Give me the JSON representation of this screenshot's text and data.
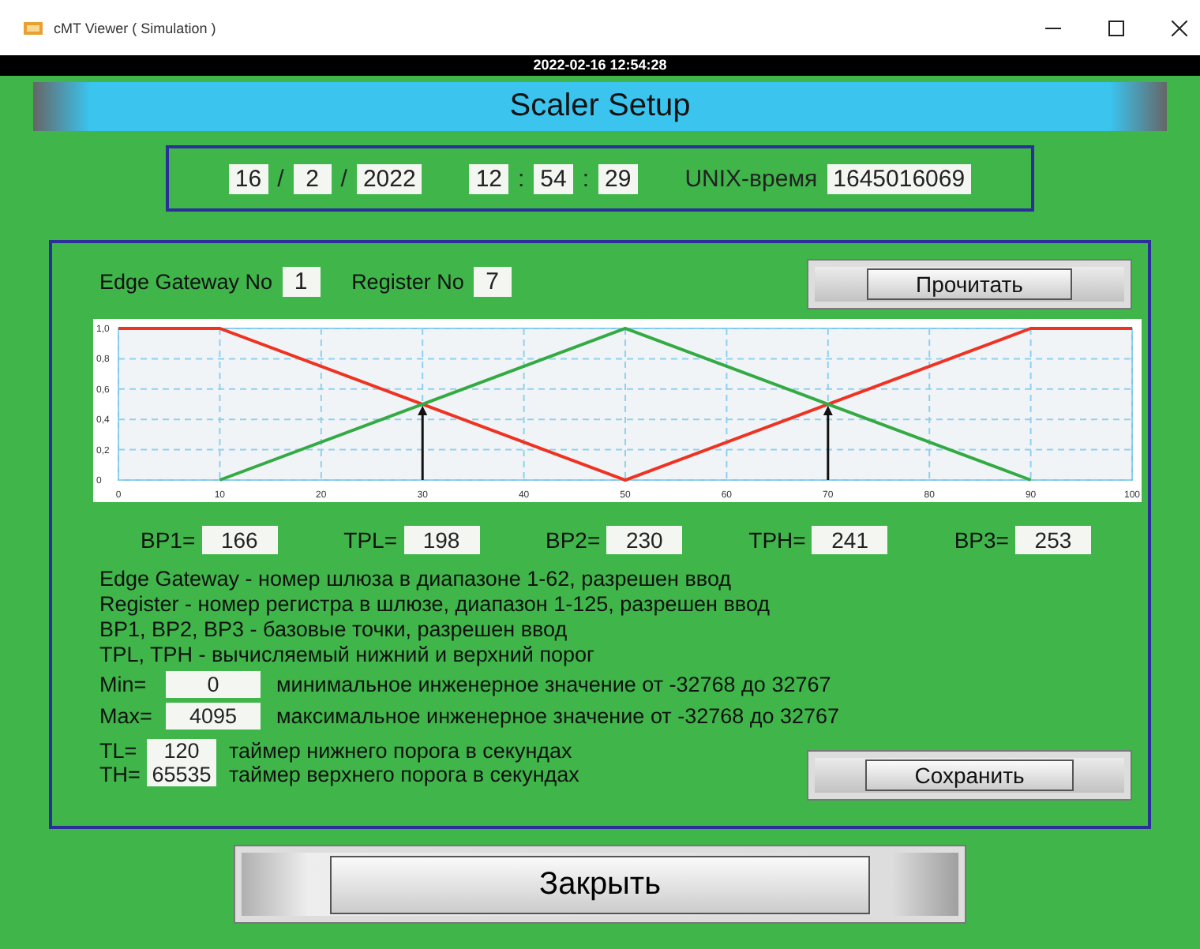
{
  "window": {
    "title": "cMT Viewer ( Simulation )"
  },
  "status_bar": {
    "datetime": "2022-02-16 12:54:28"
  },
  "header": {
    "title": "Scaler Setup"
  },
  "date_time": {
    "fields": [
      {
        "value": "16",
        "sep": "/"
      },
      {
        "value": "2",
        "sep": "/"
      },
      {
        "value": "2022"
      },
      {
        "value": "12",
        "sep": ":"
      },
      {
        "value": "54",
        "sep": ":"
      },
      {
        "value": "29"
      }
    ],
    "unix_label": "UNIX-время",
    "unix_value": "1645016069"
  },
  "gateway": {
    "label": "Edge Gateway No",
    "value": "1"
  },
  "register": {
    "label": "Register No",
    "value": "7"
  },
  "read_button": "Прочитать",
  "chart_data": {
    "type": "line",
    "x": [
      0,
      10,
      50,
      90,
      100
    ],
    "series": [
      {
        "color": "#ee3322",
        "values": [
          1,
          1,
          0,
          1,
          1
        ]
      },
      {
        "color": "#33aa44",
        "values": [
          null,
          0,
          1,
          0,
          null
        ]
      }
    ],
    "grid": true,
    "xlim": [
      0,
      100
    ],
    "ylim": [
      0,
      1
    ],
    "xticks": [
      0,
      10,
      20,
      30,
      40,
      50,
      60,
      70,
      80,
      90,
      100
    ],
    "yticks": [
      {
        "value": 0,
        "label": "0"
      },
      {
        "value": 0.2,
        "label": "0,2"
      },
      {
        "value": 0.4,
        "label": "0,4"
      },
      {
        "value": 0.6,
        "label": "0,6"
      },
      {
        "value": 0.8,
        "label": "0,8"
      },
      {
        "value": 1,
        "label": "1,0"
      }
    ]
  },
  "points": [
    {
      "label": "BP1=",
      "value": "166"
    },
    {
      "label": "TPL=",
      "value": "198"
    },
    {
      "label": "BP2=",
      "value": "230"
    },
    {
      "label": "TPH=",
      "value": "241"
    },
    {
      "label": "BP3=",
      "value": "253"
    }
  ],
  "notes": [
    "Edge Gateway - номер шлюза в диапазоне 1-62, разрешен ввод",
    "Register - номер регистра в шлюзе, диапазон 1-125, разрешен ввод",
    "BP1, BP2, BP3 - базовые точки, разрешен ввод",
    "TPL, TPH - вычисляемый нижний и верхний порог"
  ],
  "limits": [
    {
      "label": "Min=",
      "value": "0",
      "description": "минимальное инженерное значение от  -32768 до 32767"
    },
    {
      "label": "Max=",
      "value": "4095",
      "description": "максимальное инженерное значение от  -32768 до 32767"
    }
  ],
  "timers": [
    {
      "label": "TL=",
      "value": "120",
      "description": "таймер нижнего порога в секундах"
    },
    {
      "label": "TH=",
      "value": "65535",
      "description": "таймер верхнего порога в секундах"
    }
  ],
  "save_button": "Сохранить",
  "close_button": "Закрыть"
}
